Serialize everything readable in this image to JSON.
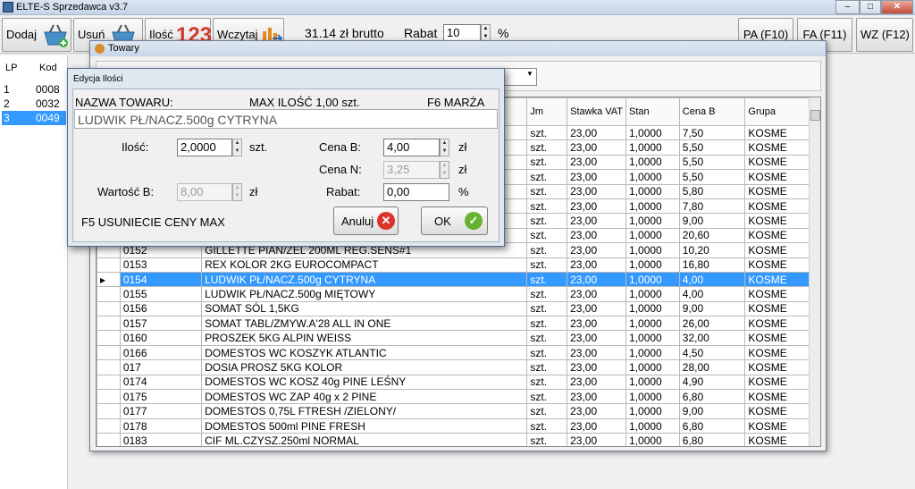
{
  "app": {
    "title": "ELTE-S  Sprzedawca v3.7"
  },
  "window_controls": {
    "minimize": "–",
    "maximize": "□",
    "close": "✕"
  },
  "toolbar": {
    "dodaj": "Dodaj",
    "usun": "Usuń",
    "ilosc": "Ilość",
    "ilosc_icon_text": "123",
    "wczytaj": "Wczytaj",
    "total": "31.14 zł brutto",
    "rabat_label": "Rabat",
    "rabat_value": "10",
    "rabat_unit": "%",
    "pa": "PA (F10)",
    "fa": "FA (F11)",
    "wz": "WZ (F12)"
  },
  "left_list": {
    "headers": {
      "lp": "LP",
      "kod": "Kod"
    },
    "rows": [
      {
        "lp": "1",
        "kod": "0008"
      },
      {
        "lp": "2",
        "kod": "0032"
      },
      {
        "lp": "3",
        "kod": "0049"
      }
    ]
  },
  "towary": {
    "title": "Towary",
    "grid_headers": {
      "kod": "",
      "nazwa": "",
      "jm": "Jm",
      "vat": "Stawka VAT",
      "stan": "Stan",
      "cena": "Cena B",
      "grupa": "Grupa"
    },
    "rows": [
      {
        "kod": "",
        "nazwa": "",
        "jm": "szt.",
        "vat": "23,00",
        "stan": "1,0000",
        "cena": "7,50",
        "grupa": "KOSME"
      },
      {
        "kod": "",
        "nazwa": "",
        "jm": "szt.",
        "vat": "23,00",
        "stan": "1,0000",
        "cena": "5,50",
        "grupa": "KOSME"
      },
      {
        "kod": "",
        "nazwa": "",
        "jm": "szt.",
        "vat": "23,00",
        "stan": "1,0000",
        "cena": "5,50",
        "grupa": "KOSME"
      },
      {
        "kod": "",
        "nazwa": "",
        "jm": "szt.",
        "vat": "23,00",
        "stan": "1,0000",
        "cena": "5,50",
        "grupa": "KOSME"
      },
      {
        "kod": "",
        "nazwa": "",
        "jm": "szt.",
        "vat": "23,00",
        "stan": "1,0000",
        "cena": "5,80",
        "grupa": "KOSME"
      },
      {
        "kod": "",
        "nazwa": "",
        "jm": "szt.",
        "vat": "23,00",
        "stan": "1,0000",
        "cena": "7,80",
        "grupa": "KOSME"
      },
      {
        "kod": "",
        "nazwa": "",
        "jm": "szt.",
        "vat": "23,00",
        "stan": "1,0000",
        "cena": "9,00",
        "grupa": "KOSME"
      },
      {
        "kod": "",
        "nazwa": "",
        "jm": "szt.",
        "vat": "23,00",
        "stan": "1,0000",
        "cena": "20,60",
        "grupa": "KOSME"
      },
      {
        "kod": "0152",
        "nazwa": "GILLETTE PIAN/ŻEL 200ML REG.SENS#1",
        "jm": "szt.",
        "vat": "23,00",
        "stan": "1,0000",
        "cena": "10,20",
        "grupa": "KOSME"
      },
      {
        "kod": "0153",
        "nazwa": "REX KOLOR 2KG EUROCOMPACT",
        "jm": "szt.",
        "vat": "23,00",
        "stan": "1,0000",
        "cena": "16,80",
        "grupa": "KOSME"
      },
      {
        "kod": "0154",
        "nazwa": "LUDWIK PŁ/NACZ.500g CYTRYNA",
        "jm": "szt.",
        "vat": "23,00",
        "stan": "1,0000",
        "cena": "4,00",
        "grupa": "KOSME",
        "selected": true
      },
      {
        "kod": "0155",
        "nazwa": "LUDWIK PŁ/NACZ.500g MIĘTOWY",
        "jm": "szt.",
        "vat": "23,00",
        "stan": "1,0000",
        "cena": "4,00",
        "grupa": "KOSME"
      },
      {
        "kod": "0156",
        "nazwa": "SOMAT SÓL 1,5KG",
        "jm": "szt.",
        "vat": "23,00",
        "stan": "1,0000",
        "cena": "9,00",
        "grupa": "KOSME"
      },
      {
        "kod": "0157",
        "nazwa": "SOMAT TABL/ZMYW.A'28 ALL IN ONE",
        "jm": "szt.",
        "vat": "23,00",
        "stan": "1,0000",
        "cena": "26,00",
        "grupa": "KOSME"
      },
      {
        "kod": "0160",
        "nazwa": "PROSZEK 5KG ALPIN WEISS",
        "jm": "szt.",
        "vat": "23,00",
        "stan": "1,0000",
        "cena": "32,00",
        "grupa": "KOSME"
      },
      {
        "kod": "0166",
        "nazwa": "DOMESTOS WC KOSZYK ATLANTIC",
        "jm": "szt.",
        "vat": "23,00",
        "stan": "1,0000",
        "cena": "4,50",
        "grupa": "KOSME"
      },
      {
        "kod": "017",
        "nazwa": "DOSIA PROSZ 5KG KOLOR",
        "jm": "szt.",
        "vat": "23,00",
        "stan": "1,0000",
        "cena": "28,00",
        "grupa": "KOSME"
      },
      {
        "kod": "0174",
        "nazwa": "DOMESTOS WC KOSZ 40g PINE LEŚNY",
        "jm": "szt.",
        "vat": "23,00",
        "stan": "1,0000",
        "cena": "4,90",
        "grupa": "KOSME"
      },
      {
        "kod": "0175",
        "nazwa": "DOMESTOS WC ZAP 40g x 2 PINE",
        "jm": "szt.",
        "vat": "23,00",
        "stan": "1,0000",
        "cena": "6,80",
        "grupa": "KOSME"
      },
      {
        "kod": "0177",
        "nazwa": "DOMESTOS 0,75L FTRESH /ZIELONY/",
        "jm": "szt.",
        "vat": "23,00",
        "stan": "1,0000",
        "cena": "9,00",
        "grupa": "KOSME"
      },
      {
        "kod": "0178",
        "nazwa": "DOMESTOS 500ml PINE FRESH",
        "jm": "szt.",
        "vat": "23,00",
        "stan": "1,0000",
        "cena": "6,80",
        "grupa": "KOSME"
      },
      {
        "kod": "0183",
        "nazwa": "CIF ML.CZYSZ.250ml NORMAL",
        "jm": "szt.",
        "vat": "23,00",
        "stan": "1,0000",
        "cena": "6,80",
        "grupa": "KOSME"
      }
    ]
  },
  "dialog": {
    "title": "Edycja Ilości",
    "name_label": "NAZWA TOWARU:",
    "max_label": "MAX ILOŚĆ 1,00 szt.",
    "f6_label": "F6  MARŻA",
    "product_name": "LUDWIK PŁ/NACZ.500g CYTRYNA",
    "ilosc_label": "Ilość:",
    "ilosc_value": "2,0000",
    "ilosc_unit": "szt.",
    "cena_b_label": "Cena B:",
    "cena_b_value": "4,00",
    "cena_b_unit": "zł",
    "cena_n_label": "Cena N:",
    "cena_n_value": "3,25",
    "cena_n_unit": "zł",
    "wartosc_label": "Wartość B:",
    "wartosc_value": "8,00",
    "wartosc_unit": "zł",
    "rabat_label": "Rabat:",
    "rabat_value": "0,00",
    "rabat_unit": "%",
    "f5_label": "F5 USUNIECIE CENY MAX",
    "cancel": "Anuluj",
    "ok": "OK"
  }
}
